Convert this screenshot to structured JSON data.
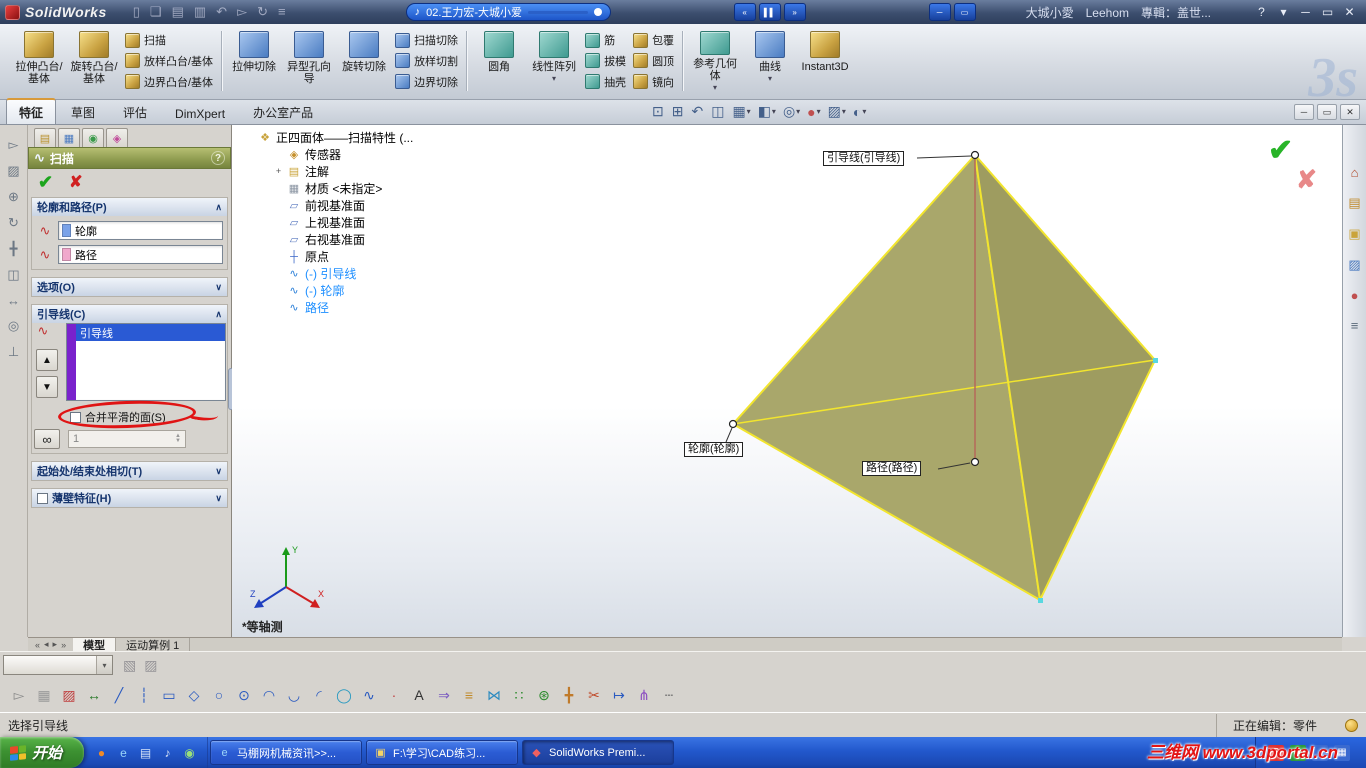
{
  "titlebar": {
    "app_name": "SolidWorks",
    "menu_toolbar_icons": [
      {
        "name": "new-document-icon",
        "glyph": "▯"
      },
      {
        "name": "open-document-icon",
        "glyph": "❏"
      },
      {
        "name": "save-icon",
        "glyph": "▤"
      },
      {
        "name": "print-icon",
        "glyph": "▥"
      },
      {
        "name": "undo-icon",
        "glyph": "↶"
      },
      {
        "name": "select-arrow-icon",
        "glyph": "▻"
      },
      {
        "name": "rebuild-icon",
        "glyph": "↻"
      },
      {
        "name": "options-icon",
        "glyph": "≡"
      }
    ],
    "media_player": {
      "note_icon": "♪",
      "track_title": "02.王力宏-大城小爱",
      "control_icons": [
        {
          "name": "previous-track-icon",
          "glyph": "«"
        },
        {
          "name": "pause-icon",
          "glyph": "▌▌"
        },
        {
          "name": "next-track-icon",
          "glyph": "»"
        }
      ],
      "mini_window_icons": [
        {
          "name": "player-minimize-icon",
          "glyph": "─"
        },
        {
          "name": "player-restore-icon",
          "glyph": "▭"
        }
      ]
    },
    "song_info": "大城小愛　Leehom　專輯：盖世...",
    "window_control_icons": [
      {
        "name": "help-icon",
        "glyph": "?"
      },
      {
        "name": "pushpin-icon",
        "glyph": "▾"
      },
      {
        "name": "minimize-icon",
        "glyph": "─"
      },
      {
        "name": "maximize-icon",
        "glyph": "▭"
      },
      {
        "name": "close-icon",
        "glyph": "✕"
      }
    ]
  },
  "ribbon": {
    "big_buttons": [
      {
        "label": "拉伸凸台/基体"
      },
      {
        "label": "旋转凸台/基体"
      },
      {
        "label": "拉伸切除"
      },
      {
        "label": "异型孔向导"
      },
      {
        "label": "旋转切除"
      },
      {
        "label": "圆角"
      },
      {
        "label": "线性阵列",
        "arrow": "▾"
      },
      {
        "label": "参考几何体",
        "arrow": "▾"
      },
      {
        "label": "曲线",
        "arrow": "▾"
      },
      {
        "label": "Instant3D"
      }
    ],
    "small_buttons": [
      {
        "label": "扫描"
      },
      {
        "label": "放样凸台/基体"
      },
      {
        "label": "边界凸台/基体"
      },
      {
        "label": "扫描切除"
      },
      {
        "label": "放样切割"
      },
      {
        "label": "边界切除"
      },
      {
        "label": "筋"
      },
      {
        "label": "拔模"
      },
      {
        "label": "抽壳"
      },
      {
        "label": "包覆"
      },
      {
        "label": "圆顶"
      },
      {
        "label": "镜向"
      }
    ],
    "brand_watermark": "3s"
  },
  "command_tabs": {
    "items": [
      "特征",
      "草图",
      "评估",
      "DimXpert",
      "办公室产品"
    ],
    "active": "特征"
  },
  "headsup_toolbar": [
    {
      "name": "zoom-fit-icon",
      "glyph": "⊡",
      "color": "#44608a"
    },
    {
      "name": "zoom-area-icon",
      "glyph": "⊞",
      "color": "#44608a"
    },
    {
      "name": "previous-view-icon",
      "glyph": "↶",
      "color": "#44608a"
    },
    {
      "name": "section-view-icon",
      "glyph": "◫",
      "color": "#44608a"
    },
    {
      "name": "view-orientation-icon",
      "glyph": "▦",
      "color": "#44608a",
      "arrow": "▾"
    },
    {
      "name": "display-style-icon",
      "glyph": "◧",
      "color": "#44608a",
      "arrow": "▾"
    },
    {
      "name": "hide-show-items-icon",
      "glyph": "◎",
      "color": "#44608a",
      "arrow": "▾"
    },
    {
      "name": "edit-appearance-icon",
      "glyph": "●",
      "color": "#c05050",
      "arrow": "▾"
    },
    {
      "name": "apply-scene-icon",
      "glyph": "▨",
      "color": "#44608a",
      "arrow": "▾"
    },
    {
      "name": "view-settings-icon",
      "glyph": "◐",
      "color": "#44608a",
      "arrow": "▾"
    }
  ],
  "doc_window_icons": [
    {
      "name": "doc-minimize-icon",
      "glyph": "─"
    },
    {
      "name": "doc-restore-icon",
      "glyph": "▭"
    },
    {
      "name": "doc-close-icon",
      "glyph": "✕"
    }
  ],
  "left_toolbar": [
    {
      "name": "select-icon",
      "glyph": "▻"
    },
    {
      "name": "sketch-icon",
      "glyph": "▨"
    },
    {
      "name": "zoom-icon",
      "glyph": "⊕"
    },
    {
      "name": "rotate-view-icon",
      "glyph": "↻"
    },
    {
      "name": "pan-icon",
      "glyph": "╋"
    },
    {
      "name": "section-icon",
      "glyph": "◫"
    },
    {
      "name": "measure-icon",
      "glyph": "↔"
    },
    {
      "name": "appearance-icon",
      "glyph": "◎"
    },
    {
      "name": "normal-to-icon",
      "glyph": "⊥"
    }
  ],
  "property_manager": {
    "pane_tabs": [
      {
        "name": "featuremanager-tab-icon",
        "glyph": "▤",
        "color": "#b8902a"
      },
      {
        "name": "propertymanager-tab-icon",
        "glyph": "▦",
        "color": "#4a7ac0"
      },
      {
        "name": "configurationmanager-tab-icon",
        "glyph": "◉",
        "color": "#3a9a4a"
      },
      {
        "name": "dimxpertmanager-tab-icon",
        "glyph": "◈",
        "color": "#c04a9a"
      }
    ],
    "header": {
      "icon": "∿",
      "title": "扫描",
      "help": "?"
    },
    "ok_icon": "✔",
    "cancel_icon": "✘",
    "sections": {
      "profile_path": {
        "label": "轮廓和路径(P)",
        "chevron": "∧",
        "fields": [
          {
            "value": "轮廓",
            "chip": "#7aa2e8",
            "icon": "∿"
          },
          {
            "value": "路径",
            "chip": "#f0a8cc",
            "icon": "∿"
          }
        ]
      },
      "options": {
        "label": "选项(O)",
        "chevron": "∨"
      },
      "guide_curves": {
        "label": "引导线(C)",
        "chevron": "∧",
        "icon": "∿",
        "list": [
          {
            "label": "引导线"
          }
        ],
        "move_up_icon": "▲",
        "move_down_icon": "▼",
        "checkbox_label": "合并平滑的面(S)",
        "checkbox_checked": false,
        "show_sections_icon": "∞",
        "spin_value": "1",
        "spin_up_icon": "▲",
        "spin_down_icon": "▼",
        "callout_color": "#7a22cc",
        "selection_color": "#2a5ad4"
      },
      "start_end_tangency": {
        "label": "起始处/结束处相切(T)",
        "chevron": "∨"
      },
      "thin_feature": {
        "label": "薄壁特征(H)",
        "chevron": "∨",
        "checkbox_checked": false
      }
    }
  },
  "feature_tree": {
    "root": {
      "text": "正四面体——扫描特性  (...",
      "glyph": "❖",
      "color": "#c8a23a"
    },
    "items": [
      {
        "text": "传感器",
        "name": "sensors-icon",
        "glyph": "◈",
        "color": "#c58f2a",
        "text_color": "#000000"
      },
      {
        "text": "注解",
        "name": "annotations-icon",
        "glyph": "▤",
        "color": "#caa43a",
        "text_color": "#000000",
        "plus": "+"
      },
      {
        "text": "材质 <未指定>",
        "name": "material-icon",
        "glyph": "▦",
        "color": "#8a94a2",
        "text_color": "#000000"
      },
      {
        "text": "前视基准面",
        "name": "plane-icon",
        "glyph": "▱",
        "color": "#5a7ac0",
        "text_color": "#000000"
      },
      {
        "text": "上视基准面",
        "name": "plane-icon",
        "glyph": "▱",
        "color": "#5a7ac0",
        "text_color": "#000000"
      },
      {
        "text": "右视基准面",
        "name": "plane-icon",
        "glyph": "▱",
        "color": "#5a7ac0",
        "text_color": "#000000"
      },
      {
        "text": "原点",
        "name": "origin-icon",
        "glyph": "┼",
        "color": "#3a66c8",
        "text_color": "#000000"
      },
      {
        "text": "(-) 引导线",
        "name": "sketch-icon",
        "glyph": "∿",
        "color": "#2a7fd8",
        "text_color": "#1e8fff"
      },
      {
        "text": "(-) 轮廓",
        "name": "sketch-icon",
        "glyph": "∿",
        "color": "#2a7fd8",
        "text_color": "#1e8fff"
      },
      {
        "text": "路径",
        "name": "sketch-icon",
        "glyph": "∿",
        "color": "#2a7fd8",
        "text_color": "#1e8fff"
      }
    ]
  },
  "viewport": {
    "model": {
      "face_color_left": "#a9a76b",
      "face_color_right": "#9e9c60",
      "edge_color": "#f2e52e",
      "path_color": "#b5685a"
    },
    "labels": {
      "guide": "引导线(引导线)",
      "profile": "轮廓(轮廓)",
      "path": "路径(路径)"
    },
    "view_name": "*等轴测",
    "triad": {
      "x": "X",
      "y": "Y",
      "z": "Z"
    },
    "confirm_ok_icon": "✔",
    "confirm_cancel_icon": "✘"
  },
  "doc_tabs": {
    "nav_icons": [
      {
        "g": "«"
      },
      {
        "g": "◂"
      },
      {
        "g": "▸"
      },
      {
        "g": "»"
      }
    ],
    "tabs": [
      "模型",
      "运动算例 1"
    ],
    "active": "模型"
  },
  "task_pane": [
    {
      "name": "home-resources-icon",
      "glyph": "⌂",
      "color": "#b04a2a"
    },
    {
      "name": "design-library-icon",
      "glyph": "▤",
      "color": "#c08a2a"
    },
    {
      "name": "file-explorer-icon",
      "glyph": "▣",
      "color": "#caa43a"
    },
    {
      "name": "view-palette-icon",
      "glyph": "▨",
      "color": "#4a7ac0"
    },
    {
      "name": "appearances-scenes-icon",
      "glyph": "●",
      "color": "#c05050"
    },
    {
      "name": "custom-properties-icon",
      "glyph": "≡",
      "color": "#5a6a7a"
    }
  ],
  "bottom_combo": {
    "value": "",
    "arrow": "▾",
    "faded_icons": [
      {
        "name": "edit-color-icon",
        "glyph": "▧"
      },
      {
        "name": "texture-icon",
        "glyph": "▨"
      }
    ]
  },
  "sketch_toolbar": [
    {
      "name": "select-icon",
      "glyph": "▻",
      "color": "#8a8a8a"
    },
    {
      "name": "grid-snap-icon",
      "glyph": "▦",
      "color": "#9a9a9a"
    },
    {
      "name": "sketch-icon",
      "glyph": "▨",
      "color": "#c04040"
    },
    {
      "name": "smart-dimension-icon",
      "glyph": "↔",
      "color": "#2a7a2a"
    },
    {
      "name": "line-icon",
      "glyph": "╱",
      "color": "#2a5ac0"
    },
    {
      "name": "centerline-icon",
      "glyph": "┆",
      "color": "#2a5ac0"
    },
    {
      "name": "rectangle-icon",
      "glyph": "▭",
      "color": "#2a5ac0"
    },
    {
      "name": "polygon-icon",
      "glyph": "◇",
      "color": "#2a5ac0"
    },
    {
      "name": "circle-icon",
      "glyph": "○",
      "color": "#2a5ac0"
    },
    {
      "name": "perimeter-circle-icon",
      "glyph": "⊙",
      "color": "#2a5ac0"
    },
    {
      "name": "centerpoint-arc-icon",
      "glyph": "◠",
      "color": "#2a5ac0"
    },
    {
      "name": "tangent-arc-icon",
      "glyph": "◡",
      "color": "#2a5ac0"
    },
    {
      "name": "three-point-arc-icon",
      "glyph": "◜",
      "color": "#2a5ac0"
    },
    {
      "name": "ellipse-icon",
      "glyph": "◯",
      "color": "#2a9ac0"
    },
    {
      "name": "spline-icon",
      "glyph": "∿",
      "color": "#2a5ac0"
    },
    {
      "name": "point-icon",
      "glyph": "·",
      "color": "#c04040"
    },
    {
      "name": "text-icon",
      "glyph": "A",
      "color": "#333333"
    },
    {
      "name": "convert-entities-icon",
      "glyph": "⇒",
      "color": "#7a5ac0"
    },
    {
      "name": "offset-entities-icon",
      "glyph": "≡",
      "color": "#c08a2a"
    },
    {
      "name": "mirror-entities-icon",
      "glyph": "⋈",
      "color": "#2a8ac0"
    },
    {
      "name": "linear-pattern-icon",
      "glyph": "∷",
      "color": "#2a8a2a"
    },
    {
      "name": "circular-pattern-icon",
      "glyph": "⊛",
      "color": "#2a8a2a"
    },
    {
      "name": "move-entities-icon",
      "glyph": "╋",
      "color": "#c07a2a"
    },
    {
      "name": "trim-entities-icon",
      "glyph": "✂",
      "color": "#c04a2a"
    },
    {
      "name": "extend-entities-icon",
      "glyph": "↦",
      "color": "#2a5ac0"
    },
    {
      "name": "split-entities-icon",
      "glyph": "⋔",
      "color": "#8a4ac0"
    },
    {
      "name": "construction-geometry-icon",
      "glyph": "┄",
      "color": "#6a6a6a"
    }
  ],
  "status_bar": {
    "left_text": "选择引导线",
    "editing_text": "正在编辑：零件"
  },
  "taskbar": {
    "start_label": "开始",
    "quick_launch": [
      {
        "name": "firefox-icon",
        "glyph": "●",
        "color": "#f08a28"
      },
      {
        "name": "ie-icon",
        "glyph": "e",
        "color": "#9ad4f8"
      },
      {
        "name": "show-desktop-icon",
        "glyph": "▤",
        "color": "#d8e4f8"
      },
      {
        "name": "media-player-icon",
        "glyph": "♪",
        "color": "#d8e4f8"
      },
      {
        "name": "messenger-icon",
        "glyph": "◉",
        "color": "#9ae07a"
      }
    ],
    "tasks": [
      {
        "label": "马棚网机械资讯>>...",
        "icon_glyph": "e",
        "icon_color": "#9ad4f8"
      },
      {
        "label": "F:\\学习\\CAD练习...",
        "icon_glyph": "▣",
        "icon_color": "#f4d468"
      },
      {
        "label": "SolidWorks Premi...",
        "icon_glyph": "◆",
        "icon_color": "#f06060"
      }
    ],
    "tray_icons": [
      {
        "name": "sogou-input-icon",
        "glyph": "S",
        "bg": "#e03030"
      },
      {
        "name": "security-icon",
        "glyph": "◉",
        "bg": "#2a9a3a"
      },
      {
        "name": "volume-icon",
        "glyph": "♪",
        "bg": "#3a6ad0"
      },
      {
        "name": "network-icon",
        "glyph": "▦",
        "bg": "#3a6ad0"
      }
    ],
    "watermark": "三维网 www.3dportal.cn"
  }
}
